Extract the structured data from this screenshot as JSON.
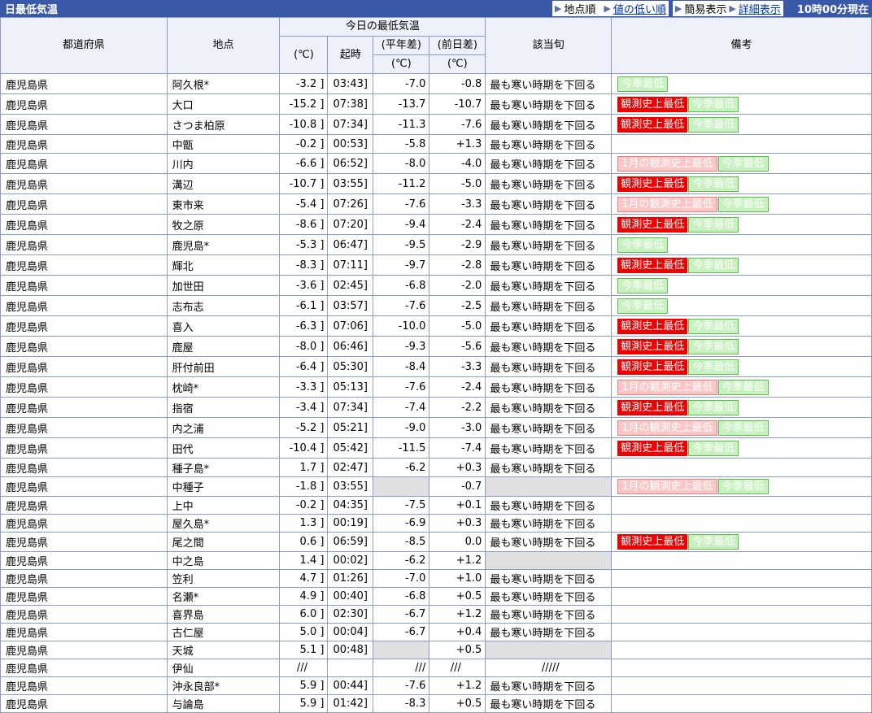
{
  "header": {
    "title": "日最低気温",
    "nav_location_order": "地点順",
    "nav_low_order": "値の低い順",
    "nav_simple": "簡易表示",
    "nav_detail": "詳細表示",
    "timestamp": "10時00分現在"
  },
  "columns": {
    "pref": "都道府県",
    "point": "地点",
    "today_group": "今日の最低気温",
    "temp_unit": "(℃)",
    "time": "起時",
    "normal_diff_label": "(平年差)",
    "normal_diff_unit": "(℃)",
    "prev_diff_label": "(前日差)",
    "prev_diff_unit": "(℃)",
    "class": "該当旬",
    "remarks": "備考"
  },
  "rows": [
    {
      "pref": "鹿児島県",
      "point": "阿久根*",
      "temp": "-3.2 ]",
      "time": "03:43]",
      "normal": "-7.0",
      "prev": "-0.8",
      "cls": "最も寒い時期を下回る",
      "badges": [
        {
          "t": "今季最低",
          "k": "green"
        }
      ]
    },
    {
      "pref": "鹿児島県",
      "point": "大口",
      "temp": "-15.2 ]",
      "time": "07:38]",
      "normal": "-13.7",
      "prev": "-10.7",
      "cls": "最も寒い時期を下回る",
      "badges": [
        {
          "t": "観測史上最低",
          "k": "red"
        },
        {
          "t": "今季最低",
          "k": "green"
        }
      ]
    },
    {
      "pref": "鹿児島県",
      "point": "さつま柏原",
      "temp": "-10.8 ]",
      "time": "07:34]",
      "normal": "-11.3",
      "prev": "-7.6",
      "cls": "最も寒い時期を下回る",
      "badges": [
        {
          "t": "観測史上最低",
          "k": "red"
        },
        {
          "t": "今季最低",
          "k": "green"
        }
      ]
    },
    {
      "pref": "鹿児島県",
      "point": "中甑",
      "temp": "-0.2 ]",
      "time": "00:53]",
      "normal": "-5.8",
      "prev": "+1.3",
      "cls": "最も寒い時期を下回る",
      "badges": []
    },
    {
      "pref": "鹿児島県",
      "point": "川内",
      "temp": "-6.6 ]",
      "time": "06:52]",
      "normal": "-8.0",
      "prev": "-4.0",
      "cls": "最も寒い時期を下回る",
      "badges": [
        {
          "t": "1月の観測史上最低",
          "k": "pink"
        },
        {
          "t": "今季最低",
          "k": "green"
        }
      ]
    },
    {
      "pref": "鹿児島県",
      "point": "溝辺",
      "temp": "-10.7 ]",
      "time": "03:55]",
      "normal": "-11.2",
      "prev": "-5.0",
      "cls": "最も寒い時期を下回る",
      "badges": [
        {
          "t": "観測史上最低",
          "k": "red"
        },
        {
          "t": "今季最低",
          "k": "green"
        }
      ]
    },
    {
      "pref": "鹿児島県",
      "point": "東市来",
      "temp": "-5.4 ]",
      "time": "07:26]",
      "normal": "-7.6",
      "prev": "-3.3",
      "cls": "最も寒い時期を下回る",
      "badges": [
        {
          "t": "1月の観測史上最低",
          "k": "pink"
        },
        {
          "t": "今季最低",
          "k": "green"
        }
      ]
    },
    {
      "pref": "鹿児島県",
      "point": "牧之原",
      "temp": "-8.6 ]",
      "time": "07:20]",
      "normal": "-9.4",
      "prev": "-2.4",
      "cls": "最も寒い時期を下回る",
      "badges": [
        {
          "t": "観測史上最低",
          "k": "red"
        },
        {
          "t": "今季最低",
          "k": "green"
        }
      ]
    },
    {
      "pref": "鹿児島県",
      "point": "鹿児島*",
      "temp": "-5.3 ]",
      "time": "06:47]",
      "normal": "-9.5",
      "prev": "-2.9",
      "cls": "最も寒い時期を下回る",
      "badges": [
        {
          "t": "今季最低",
          "k": "green"
        }
      ]
    },
    {
      "pref": "鹿児島県",
      "point": "輝北",
      "temp": "-8.3 ]",
      "time": "07:11]",
      "normal": "-9.7",
      "prev": "-2.8",
      "cls": "最も寒い時期を下回る",
      "badges": [
        {
          "t": "観測史上最低",
          "k": "red"
        },
        {
          "t": "今季最低",
          "k": "green"
        }
      ]
    },
    {
      "pref": "鹿児島県",
      "point": "加世田",
      "temp": "-3.6 ]",
      "time": "02:45]",
      "normal": "-6.8",
      "prev": "-2.0",
      "cls": "最も寒い時期を下回る",
      "badges": [
        {
          "t": "今季最低",
          "k": "green"
        }
      ]
    },
    {
      "pref": "鹿児島県",
      "point": "志布志",
      "temp": "-6.1 ]",
      "time": "03:57]",
      "normal": "-7.6",
      "prev": "-2.5",
      "cls": "最も寒い時期を下回る",
      "badges": [
        {
          "t": "今季最低",
          "k": "green"
        }
      ]
    },
    {
      "pref": "鹿児島県",
      "point": "喜入",
      "temp": "-6.3 ]",
      "time": "07:06]",
      "normal": "-10.0",
      "prev": "-5.0",
      "cls": "最も寒い時期を下回る",
      "badges": [
        {
          "t": "観測史上最低",
          "k": "red"
        },
        {
          "t": "今季最低",
          "k": "green"
        }
      ]
    },
    {
      "pref": "鹿児島県",
      "point": "鹿屋",
      "temp": "-8.0 ]",
      "time": "06:46]",
      "normal": "-9.3",
      "prev": "-5.6",
      "cls": "最も寒い時期を下回る",
      "badges": [
        {
          "t": "観測史上最低",
          "k": "red"
        },
        {
          "t": "今季最低",
          "k": "green"
        }
      ]
    },
    {
      "pref": "鹿児島県",
      "point": "肝付前田",
      "temp": "-6.4 ]",
      "time": "05:30]",
      "normal": "-8.4",
      "prev": "-3.3",
      "cls": "最も寒い時期を下回る",
      "badges": [
        {
          "t": "観測史上最低",
          "k": "red"
        },
        {
          "t": "今季最低",
          "k": "green"
        }
      ]
    },
    {
      "pref": "鹿児島県",
      "point": "枕崎*",
      "temp": "-3.3 ]",
      "time": "05:13]",
      "normal": "-7.6",
      "prev": "-2.4",
      "cls": "最も寒い時期を下回る",
      "badges": [
        {
          "t": "1月の観測史上最低",
          "k": "pink"
        },
        {
          "t": "今季最低",
          "k": "green"
        }
      ]
    },
    {
      "pref": "鹿児島県",
      "point": "指宿",
      "temp": "-3.4 ]",
      "time": "07:34]",
      "normal": "-7.4",
      "prev": "-2.2",
      "cls": "最も寒い時期を下回る",
      "badges": [
        {
          "t": "観測史上最低",
          "k": "red"
        },
        {
          "t": "今季最低",
          "k": "green"
        }
      ]
    },
    {
      "pref": "鹿児島県",
      "point": "内之浦",
      "temp": "-5.2 ]",
      "time": "05:21]",
      "normal": "-9.0",
      "prev": "-3.0",
      "cls": "最も寒い時期を下回る",
      "badges": [
        {
          "t": "1月の観測史上最低",
          "k": "pink"
        },
        {
          "t": "今季最低",
          "k": "green"
        }
      ]
    },
    {
      "pref": "鹿児島県",
      "point": "田代",
      "temp": "-10.4 ]",
      "time": "05:42]",
      "normal": "-11.5",
      "prev": "-7.4",
      "cls": "最も寒い時期を下回る",
      "badges": [
        {
          "t": "観測史上最低",
          "k": "red"
        },
        {
          "t": "今季最低",
          "k": "green"
        }
      ]
    },
    {
      "pref": "鹿児島県",
      "point": "種子島*",
      "temp": "1.7 ]",
      "time": "02:47]",
      "normal": "-6.2",
      "prev": "+0.3",
      "cls": "最も寒い時期を下回る",
      "badges": []
    },
    {
      "pref": "鹿児島県",
      "point": "中種子",
      "temp": "-1.8 ]",
      "time": "03:55]",
      "normal": "",
      "prev": "-0.7",
      "cls": "",
      "badges": [
        {
          "t": "1月の観測史上最低",
          "k": "pink"
        },
        {
          "t": "今季最低",
          "k": "green"
        }
      ],
      "grayNormal": true,
      "grayCls": true
    },
    {
      "pref": "鹿児島県",
      "point": "上中",
      "temp": "-0.2 ]",
      "time": "04:35]",
      "normal": "-7.5",
      "prev": "+0.1",
      "cls": "最も寒い時期を下回る",
      "badges": []
    },
    {
      "pref": "鹿児島県",
      "point": "屋久島*",
      "temp": "1.3 ]",
      "time": "00:19]",
      "normal": "-6.9",
      "prev": "+0.3",
      "cls": "最も寒い時期を下回る",
      "badges": []
    },
    {
      "pref": "鹿児島県",
      "point": "尾之間",
      "temp": "0.6 ]",
      "time": "06:59]",
      "normal": "-8.5",
      "prev": "0.0",
      "cls": "最も寒い時期を下回る",
      "badges": [
        {
          "t": "観測史上最低",
          "k": "red"
        },
        {
          "t": "今季最低",
          "k": "green"
        }
      ]
    },
    {
      "pref": "鹿児島県",
      "point": "中之島",
      "temp": "1.4 ]",
      "time": "00:02]",
      "normal": "-6.2",
      "prev": "+1.2",
      "cls": "",
      "badges": [],
      "grayCls": true
    },
    {
      "pref": "鹿児島県",
      "point": "笠利",
      "temp": "4.7 ]",
      "time": "01:26]",
      "normal": "-7.0",
      "prev": "+1.0",
      "cls": "最も寒い時期を下回る",
      "badges": []
    },
    {
      "pref": "鹿児島県",
      "point": "名瀬*",
      "temp": "4.9 ]",
      "time": "00:40]",
      "normal": "-6.8",
      "prev": "+0.5",
      "cls": "最も寒い時期を下回る",
      "badges": []
    },
    {
      "pref": "鹿児島県",
      "point": "喜界島",
      "temp": "6.0 ]",
      "time": "02:30]",
      "normal": "-6.7",
      "prev": "+1.2",
      "cls": "最も寒い時期を下回る",
      "badges": []
    },
    {
      "pref": "鹿児島県",
      "point": "古仁屋",
      "temp": "5.0 ]",
      "time": "00:04]",
      "normal": "-6.7",
      "prev": "+0.4",
      "cls": "最も寒い時期を下回る",
      "badges": []
    },
    {
      "pref": "鹿児島県",
      "point": "天城",
      "temp": "5.1 ]",
      "time": "00:48]",
      "normal": "",
      "prev": "+0.5",
      "cls": "",
      "badges": [],
      "grayNormal": true,
      "grayCls": true
    },
    {
      "pref": "鹿児島県",
      "point": "伊仙",
      "temp": "///",
      "time": "",
      "normal": "///",
      "prev": "///",
      "cls": "/////",
      "badges": [],
      "centerCls": true
    },
    {
      "pref": "鹿児島県",
      "point": "沖永良部*",
      "temp": "5.9 ]",
      "time": "00:44]",
      "normal": "-7.6",
      "prev": "+1.2",
      "cls": "最も寒い時期を下回る",
      "badges": []
    },
    {
      "pref": "鹿児島県",
      "point": "与論島",
      "temp": "5.9 ]",
      "time": "01:42]",
      "normal": "-8.3",
      "prev": "+0.5",
      "cls": "最も寒い時期を下回る",
      "badges": []
    }
  ]
}
